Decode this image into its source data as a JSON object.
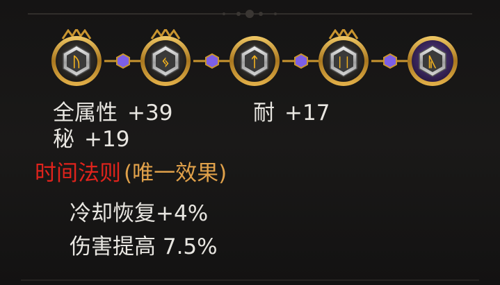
{
  "runeword": {
    "runes": [
      {
        "glyph": "ᚢ",
        "name": "rune-1"
      },
      {
        "glyph": "ᛃ",
        "name": "rune-2"
      },
      {
        "glyph": "ᛏ",
        "name": "rune-3"
      },
      {
        "glyph": "ᛁᛁ",
        "name": "rune-4"
      },
      {
        "glyph": "ᚣ",
        "name": "rune-5"
      }
    ],
    "colors": {
      "gold": "#c9952f",
      "active_ring": "#5a3b8a",
      "link_gem": "#8a6cf0",
      "rune_glow": "#f3b21f"
    }
  },
  "stats": {
    "all_attributes": {
      "label": "全属性",
      "value": "+39"
    },
    "endurance": {
      "label": "耐",
      "value": "+17"
    },
    "arcane": {
      "label": "秘",
      "value": "+19"
    }
  },
  "unique_effect": {
    "name": "时间法则",
    "tag": "(唯一效果)",
    "lines": [
      "冷却恢复+4%",
      "伤害提高 7.5%"
    ]
  }
}
